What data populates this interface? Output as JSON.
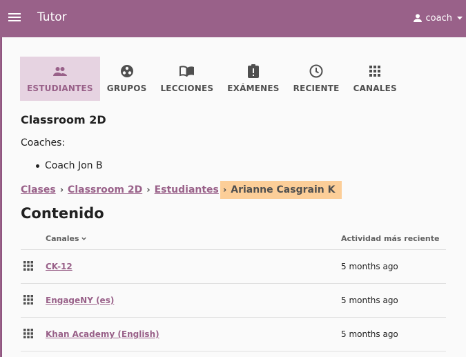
{
  "appbar": {
    "title": "Tutor",
    "user": "coach",
    "menu_icon": "hamburger-menu-icon",
    "user_icon": "person-icon",
    "dropdown_icon": "caret-down-icon"
  },
  "tabs": [
    {
      "label": "ESTUDIANTES",
      "icon": "people-icon",
      "active": true
    },
    {
      "label": "GRUPOS",
      "icon": "groups-icon",
      "active": false
    },
    {
      "label": "LECCIONES",
      "icon": "book-icon",
      "active": false
    },
    {
      "label": "EXÁMENES",
      "icon": "exam-icon",
      "active": false
    },
    {
      "label": "RECIENTE",
      "icon": "clock-icon",
      "active": false
    },
    {
      "label": "CANALES",
      "icon": "grid-icon",
      "active": false
    }
  ],
  "classroom": {
    "name": "Classroom 2D",
    "coaches_label": "Coaches:",
    "coaches": [
      "Coach Jon B"
    ]
  },
  "breadcrumb": {
    "items": [
      "Clases",
      "Classroom 2D",
      "Estudiantes"
    ],
    "current": "Arianne Casgrain K",
    "separator": "›"
  },
  "content": {
    "title": "Contenido",
    "columns": {
      "channels": "Canales",
      "activity": "Actividad más reciente"
    },
    "rows": [
      {
        "channel": "CK-12",
        "activity": "5 months ago"
      },
      {
        "channel": "EngageNY (es)",
        "activity": "5 months ago"
      },
      {
        "channel": "Khan Academy (English)",
        "activity": "5 months ago"
      }
    ]
  },
  "colors": {
    "brand": "#996189",
    "active_tab_bg": "#e6d3e1",
    "breadcrumb_highlight": "#fcce98"
  }
}
